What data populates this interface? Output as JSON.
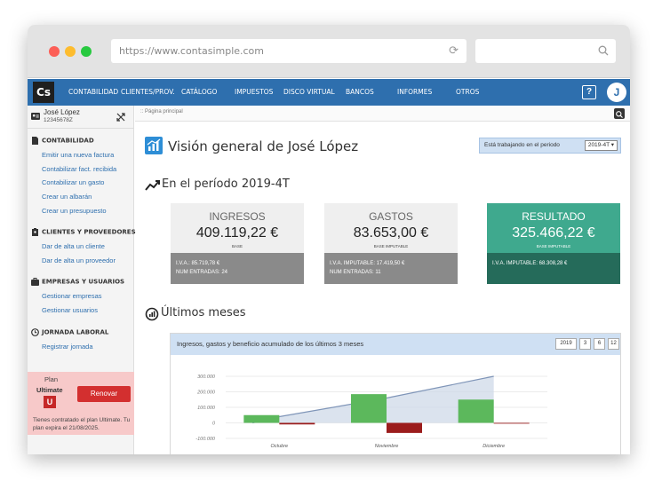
{
  "browser": {
    "url": "https://www.contasimple.com"
  },
  "nav": {
    "logo": "Cs",
    "items": [
      "CONTABILIDAD",
      "CLIENTES/PROV.",
      "CATÁLOGO",
      "IMPUESTOS",
      "DISCO VIRTUAL",
      "BANCOS",
      "INFORMES",
      "OTROS"
    ],
    "help": "?",
    "avatar": "J"
  },
  "user": {
    "name": "José López",
    "nif": "12345678Z"
  },
  "sidebar": {
    "sections": [
      {
        "title": "CONTABILIDAD",
        "links": [
          "Emitir una nueva factura",
          "Contabilizar fact. recibida",
          "Contabilizar un gasto",
          "Crear un albarán",
          "Crear un presupuesto"
        ]
      },
      {
        "title": "CLIENTES Y PROVEEDORES",
        "links": [
          "Dar de alta un cliente",
          "Dar de alta un proveedor"
        ]
      },
      {
        "title": "EMPRESAS Y USUARIOS",
        "links": [
          "Gestionar empresas",
          "Gestionar usuarios"
        ]
      },
      {
        "title": "JORNADA LABORAL",
        "links": [
          "Registrar jornada"
        ]
      }
    ]
  },
  "plan": {
    "label": "Plan",
    "name": "Ultimate",
    "badge": "U",
    "renew": "Renovar",
    "note": "Tienes contratado el plan Ultimate. Tu plan expira el 21/08/2025."
  },
  "breadcrumb": ":: Página principal",
  "main": {
    "title": "Visión general de José López",
    "period_label": "Está trabajando en el periodo",
    "period_value": "2019-4T ▾",
    "period_heading": "En el período 2019-4T",
    "months_heading": "Últimos meses"
  },
  "kpis": {
    "ingresos": {
      "title": "INGRESOS",
      "value": "409.119,22 €",
      "base": "BASE",
      "line1": "I.V.A.: 85.719,78 €",
      "line2": "NUM ENTRADAS: 24"
    },
    "gastos": {
      "title": "GASTOS",
      "value": "83.653,00 €",
      "base": "BASE IMPUTABLE",
      "line1": "I.V.A. IMPUTABLE: 17.419,50 €",
      "line2": "NUM ENTRADAS: 11"
    },
    "resultado": {
      "title": "RESULTADO",
      "value": "325.466,22 €",
      "base": "BASE IMPUTABLE",
      "line1": "I.V.A. IMPUTABLE: 68.308,28 €"
    }
  },
  "chart_panel": {
    "title": "Ingresos, gastos y beneficio acumulado de los últimos 3 meses",
    "buttons": [
      "2019",
      "3",
      "6",
      "12"
    ]
  },
  "colors": {
    "nav": "#2e6fae",
    "ingresos": "#5cb85c",
    "gastos": "#9b1c1c",
    "acumulado_line": "#7f95b8",
    "resultado": "#3fa98e"
  },
  "chart_data": {
    "type": "bar",
    "categories": [
      "Octubre",
      "Noviembre",
      "Diciembre"
    ],
    "series": [
      {
        "values": [
          50000,
          185000,
          150000
        ]
      },
      {
        "values": [
          -10000,
          -65000,
          -5000
        ]
      },
      {
        "values": [
          40000,
          160000,
          300000
        ]
      }
    ],
    "yticks": [
      "300.000",
      "200.000",
      "100.000",
      "0",
      "-100.000"
    ],
    "ylim": [
      -100000,
      300000
    ]
  }
}
